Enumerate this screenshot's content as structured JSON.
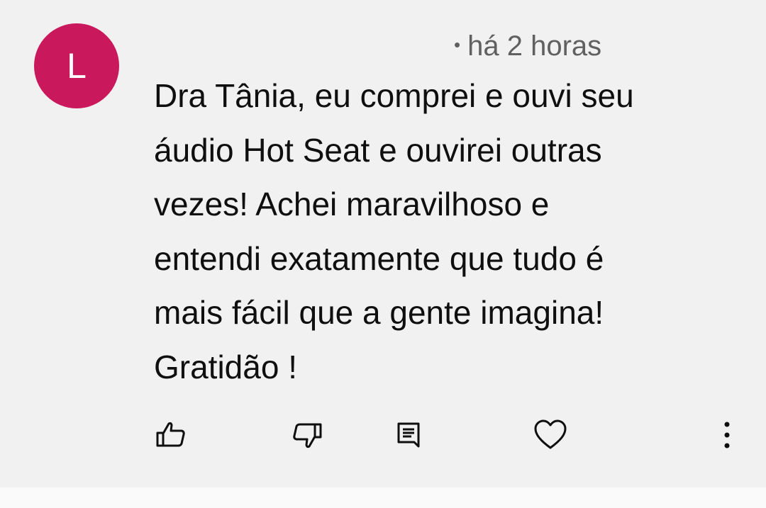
{
  "author": {
    "avatar_letter": "L",
    "avatar_color": "#c9185b"
  },
  "meta": {
    "separator": "•",
    "time_ago": "há 2 horas"
  },
  "comment": {
    "text": "Dra Tânia, eu comprei e ouvi seu\náudio Hot Seat e ouvirei outras\nvezes! Achei maravilhoso e\nentendi exatamente que tudo é\nmais fácil que a gente imagina!\nGratidão !"
  },
  "actions": [
    {
      "name": "like",
      "icon": "thumbs-up-icon"
    },
    {
      "name": "dislike",
      "icon": "thumbs-down-icon"
    },
    {
      "name": "reply",
      "icon": "reply-icon"
    },
    {
      "name": "heart",
      "icon": "heart-icon"
    },
    {
      "name": "more",
      "icon": "more-vertical-icon"
    }
  ]
}
